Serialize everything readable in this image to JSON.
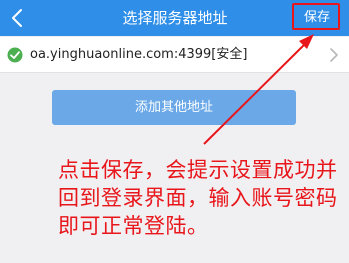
{
  "navbar": {
    "title": "选择服务器地址",
    "save_label": "保存",
    "background": "#2e8ee8"
  },
  "server": {
    "address": "oa.yinghuaonline.com:4399[安全]",
    "check_color": "#4caf50"
  },
  "add_button": {
    "label": "添加其他地址"
  },
  "annotation": {
    "text": "点击保存，会提示设置成功并回到登录界面，输入账号密码即可正常登陆。",
    "color": "#e8161b"
  }
}
